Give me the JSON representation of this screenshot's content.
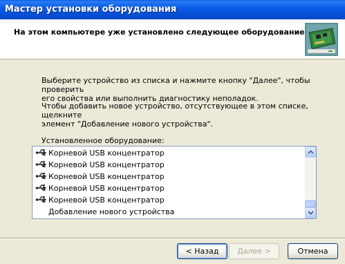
{
  "window": {
    "title": "Мастер установки оборудования"
  },
  "header": {
    "title": "На этом компьютере уже установлено следующее оборудование",
    "icon": "hardware-board-icon"
  },
  "instructions": {
    "p1_line1": "Выберите устройство из списка и нажмите кнопку \"Далее\", чтобы проверить",
    "p1_line2": "его свойства или выполнить диагностику неполадок.",
    "p2_line1": "Чтобы добавить новое устройство, отсутствующее в этом списке, щелкните",
    "p2_line2": "элемент \"Добавление нового устройства\"."
  },
  "list": {
    "label": "Установленное оборудование:",
    "items": [
      {
        "label": "Корневой USB концентратор",
        "icon": "usb-icon"
      },
      {
        "label": "Корневой USB концентратор",
        "icon": "usb-icon"
      },
      {
        "label": "Корневой USB концентратор",
        "icon": "usb-icon"
      },
      {
        "label": "Корневой USB концентратор",
        "icon": "usb-icon"
      },
      {
        "label": "Корневой USB концентратор",
        "icon": "usb-icon"
      },
      {
        "label": "Добавление нового устройства",
        "icon": ""
      }
    ]
  },
  "buttons": {
    "back": "< Назад",
    "next": "Далее >",
    "cancel": "Отмена"
  },
  "colors": {
    "titlebar": "#0a5ce6",
    "window_bg": "#ece9d8",
    "list_border": "#7f9db9"
  }
}
